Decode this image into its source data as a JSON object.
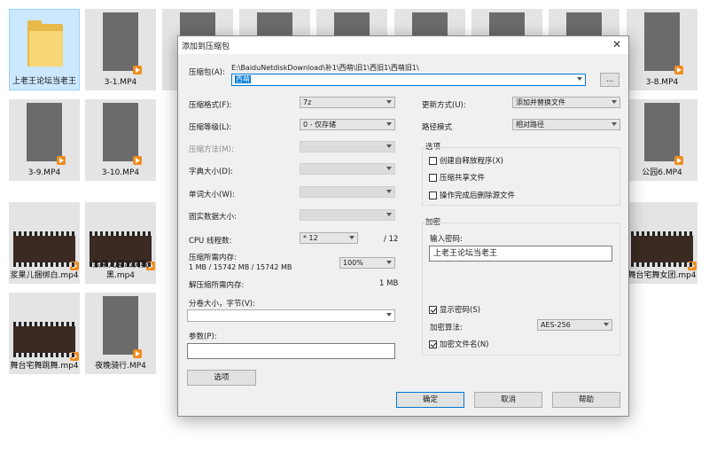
{
  "files": [
    {
      "label": "上老王论坛当老王",
      "type": "folder"
    },
    {
      "label": "3-1.MP4",
      "type": "video"
    },
    {
      "label": "",
      "type": "video"
    },
    {
      "label": "",
      "type": "video"
    },
    {
      "label": "",
      "type": "video"
    },
    {
      "label": "",
      "type": "video"
    },
    {
      "label": "",
      "type": "video"
    },
    {
      "label": "",
      "type": "video"
    },
    {
      "label": "3-8.MP4",
      "type": "video"
    },
    {
      "label": "3-9.MP4",
      "type": "video"
    },
    {
      "label": "3-10.MP4",
      "type": "video"
    },
    {
      "label": "公园6.MP4",
      "type": "video"
    },
    {
      "label": "浆果儿捆绑白.mp4",
      "type": "video"
    },
    {
      "label": "浆果儿露出调教黑.mp4",
      "type": "video"
    },
    {
      "label": "舞台宅舞女团.mp4",
      "type": "video"
    },
    {
      "label": "舞台宅舞跳舞.mp4",
      "type": "video"
    },
    {
      "label": "夜晚骑行.MP4",
      "type": "video"
    }
  ],
  "dialog": {
    "title": "添加到压缩包",
    "close_icon": "close-icon",
    "archive_label": "压缩包(A):",
    "archive_path": "E:\\BaiduNetdiskDownload\\补1\\西萌\\旧1\\西旧1\\西萌旧1\\",
    "archive_name": "西萌",
    "browse_label": "...",
    "format_label": "压缩格式(F):",
    "format_value": "7z",
    "level_label": "压缩等级(L):",
    "level_value": "0 - 仅存储",
    "method_label": "压缩方法(M):",
    "dict_label": "字典大小(D):",
    "word_label": "单词大小(W):",
    "solid_label": "固实数据大小:",
    "cpu_label": "CPU 线程数:",
    "cpu_value": "* 12",
    "cpu_total": "/ 12",
    "mem_label": "压缩所需内存:",
    "mem_detail": "1 MB / 15742 MB / 15742 MB",
    "mem_value": "100%",
    "decomp_label": "解压缩所需内存:",
    "decomp_value": "1 MB",
    "split_label": "分卷大小，字节(V):",
    "split_value": "",
    "params_label": "参数(P):",
    "params_value": "",
    "options_button": "选项",
    "update_label": "更新方式(U):",
    "update_value": "添加并替换文件",
    "pathmode_label": "路径模式",
    "pathmode_value": "相对路径",
    "options_group": "选项",
    "opt_sfx": "创建自释放程序(X)",
    "opt_shared": "压缩共享文件",
    "opt_delete": "操作完成后删除源文件",
    "encrypt_group": "加密",
    "password_label": "输入密码:",
    "password_value": "上老王论坛当老王",
    "show_password": "显示密码(S)",
    "enc_method_label": "加密算法:",
    "enc_method_value": "AES-256",
    "enc_names": "加密文件名(N)",
    "ok": "确定",
    "cancel": "取消",
    "help": "帮助"
  }
}
